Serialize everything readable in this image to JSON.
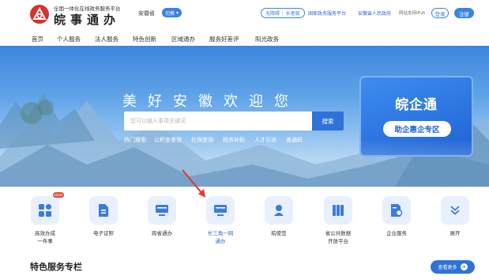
{
  "header": {
    "logo_icon": "anhui-logo-icon",
    "subtitle": "全国一体化在线政务服务平台",
    "title": "皖事通办",
    "region": "安徽省",
    "switch_label": "切换",
    "pill_links": [
      "无障碍",
      "长者版"
    ],
    "links": [
      "国家政务服务平台",
      "安徽省人民政府"
    ],
    "ipv6": "网站支持IPv6",
    "login": "登录",
    "register": "注册"
  },
  "nav": {
    "items": [
      "首页",
      "个人服务",
      "法人服务",
      "特色创新",
      "区域通办",
      "服务好差评",
      "阳光政务"
    ]
  },
  "banner": {
    "welcome": "美好安徽欢迎您",
    "search_placeholder": "您可以输入事项关键词",
    "search_button": "搜索",
    "hot_label": "热门搜索:",
    "hot_items": [
      "公积金查询",
      "社保查询",
      "税务补贴",
      "人才引进",
      "善通码"
    ],
    "qiye": {
      "title": "皖企通",
      "button": "助企惠企专区"
    }
  },
  "services": {
    "items": [
      {
        "label1": "高效办成",
        "label2": "一件事",
        "icon": "grid-apps-icon",
        "badge": "NEW"
      },
      {
        "label1": "电子证照",
        "label2": "",
        "icon": "document-icon",
        "badge": ""
      },
      {
        "label1": "跨省通办",
        "label2": "",
        "icon": "monitor-icon",
        "badge": ""
      },
      {
        "label1": "长三角一网",
        "label2": "通办",
        "icon": "monitor-icon",
        "badge": ""
      },
      {
        "label1": "皖使签",
        "label2": "",
        "icon": "user-stamp-icon",
        "badge": ""
      },
      {
        "label1": "省公共数据",
        "label2": "开放平台",
        "icon": "data-columns-icon",
        "badge": ""
      },
      {
        "label1": "企业服务",
        "label2": "",
        "icon": "enterprise-doc-icon",
        "badge": ""
      },
      {
        "label1": "展开",
        "label2": "",
        "icon": "double-chevron-down-icon",
        "badge": ""
      }
    ]
  },
  "section": {
    "title": "特色服务专栏",
    "more": "查看更多"
  },
  "colors": {
    "primary": "#2f72d8",
    "logo_red": "#d9312b",
    "accent_arrow": "#e8342f"
  }
}
